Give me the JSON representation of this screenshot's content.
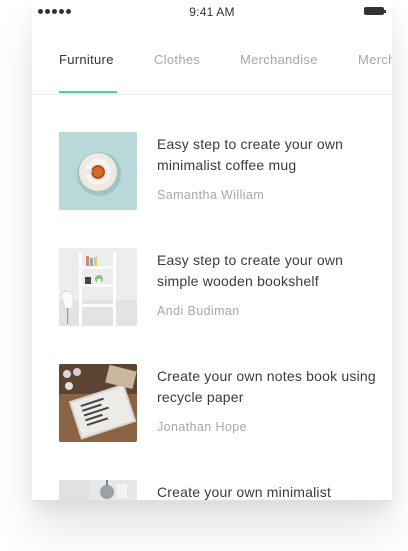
{
  "status_bar": {
    "time": "9:41 AM",
    "signal_icon": "signal-dots-icon",
    "battery_icon": "battery-icon"
  },
  "tabs": [
    {
      "label": "Furniture",
      "active": true
    },
    {
      "label": "Clothes",
      "active": false
    },
    {
      "label": "Merchandise",
      "active": false
    },
    {
      "label": "Merch",
      "active": false
    }
  ],
  "accent_color": "#4cd0a6",
  "articles": [
    {
      "title": "Easy step to create your own minimalist coffee mug",
      "author": "Samantha William",
      "thumbnail": "coffee-mug-image"
    },
    {
      "title": "Easy step to create your own simple wooden bookshelf",
      "author": "Andi Budiman",
      "thumbnail": "bookshelf-image"
    },
    {
      "title": "Create your own notes book using recycle paper",
      "author": "Jonathan Hope",
      "thumbnail": "notebook-image"
    },
    {
      "title": "Create your own minimalist",
      "author": "",
      "thumbnail": "lamp-image"
    }
  ]
}
